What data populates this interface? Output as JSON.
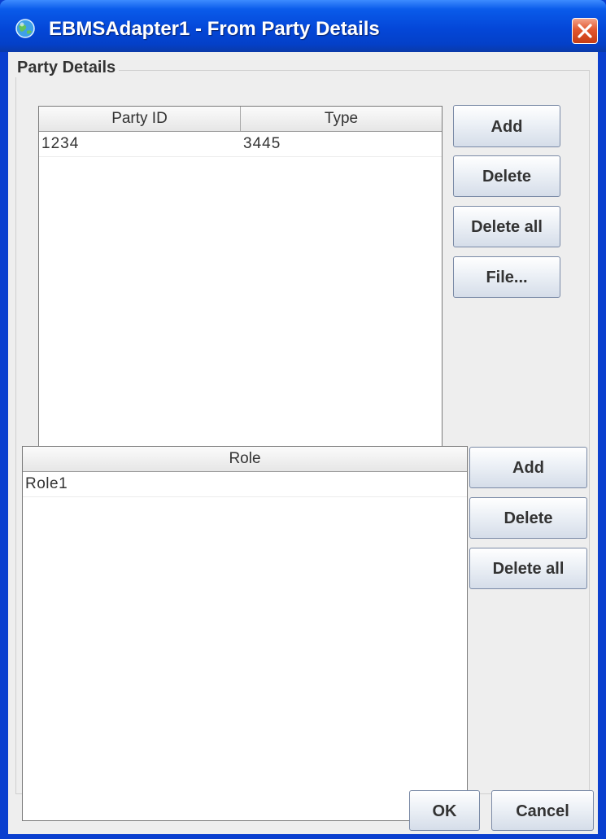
{
  "window": {
    "title": "EBMSAdapter1 - From Party Details",
    "app_icon": "globe-icon",
    "close_icon": "close-icon"
  },
  "group": {
    "title": "Party Details"
  },
  "party_table": {
    "columns": [
      "Party ID",
      "Type"
    ],
    "rows": [
      [
        "1234",
        "3445"
      ]
    ]
  },
  "party_buttons": {
    "add": "Add",
    "delete": "Delete",
    "delete_all": "Delete all",
    "file": "File..."
  },
  "role_table": {
    "columns": [
      "Role"
    ],
    "rows": [
      [
        "Role1"
      ]
    ]
  },
  "role_buttons": {
    "add": "Add",
    "delete": "Delete",
    "delete_all": "Delete all"
  },
  "dialog_buttons": {
    "ok": "OK",
    "cancel": "Cancel"
  },
  "colors": {
    "titlebar": "#0447d8",
    "close_button": "#e2572f",
    "client_background": "#eeeeee"
  }
}
